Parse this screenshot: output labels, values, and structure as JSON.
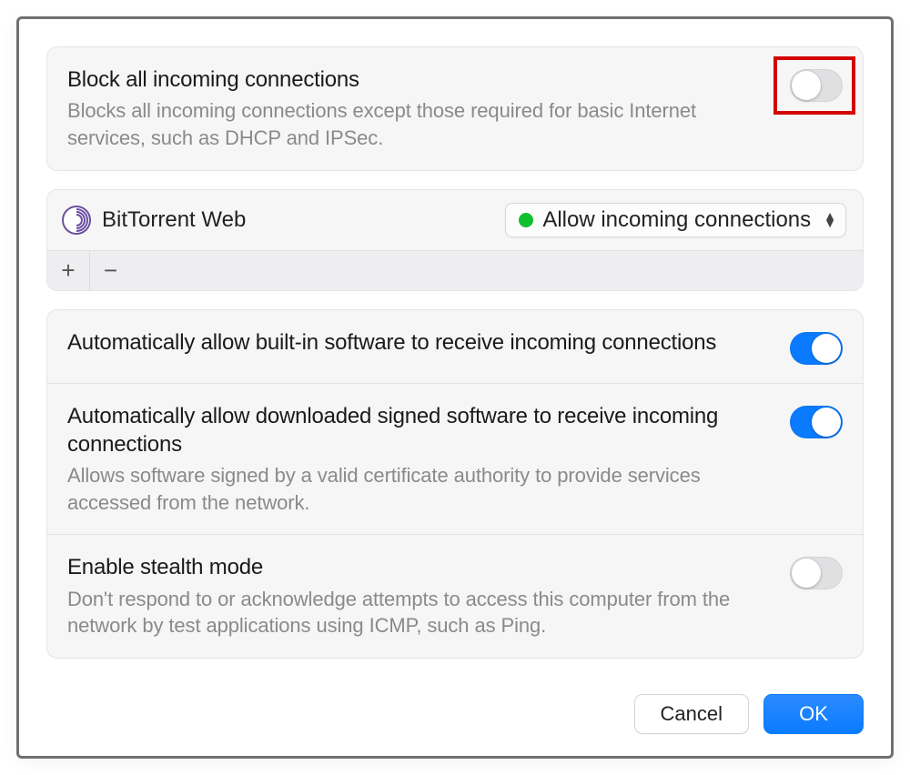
{
  "block_all": {
    "title": "Block all incoming connections",
    "desc": "Blocks all incoming connections except those required for basic Internet services, such as DHCP and IPSec.",
    "enabled": false
  },
  "apps": {
    "items": [
      {
        "name": "BitTorrent Web",
        "status_label": "Allow incoming connections",
        "status_color": "#0fbf2e"
      }
    ],
    "add_icon": "+",
    "remove_icon": "−"
  },
  "options": [
    {
      "title": "Automatically allow built-in software to receive incoming connections",
      "desc": "",
      "enabled": true
    },
    {
      "title": "Automatically allow downloaded signed software to receive incoming connections",
      "desc": "Allows software signed by a valid certificate authority to provide services accessed from the network.",
      "enabled": true
    },
    {
      "title": "Enable stealth mode",
      "desc": "Don't respond to or acknowledge attempts to access this computer from the network by test applications using ICMP, such as Ping.",
      "enabled": false
    }
  ],
  "footer": {
    "cancel": "Cancel",
    "ok": "OK"
  }
}
